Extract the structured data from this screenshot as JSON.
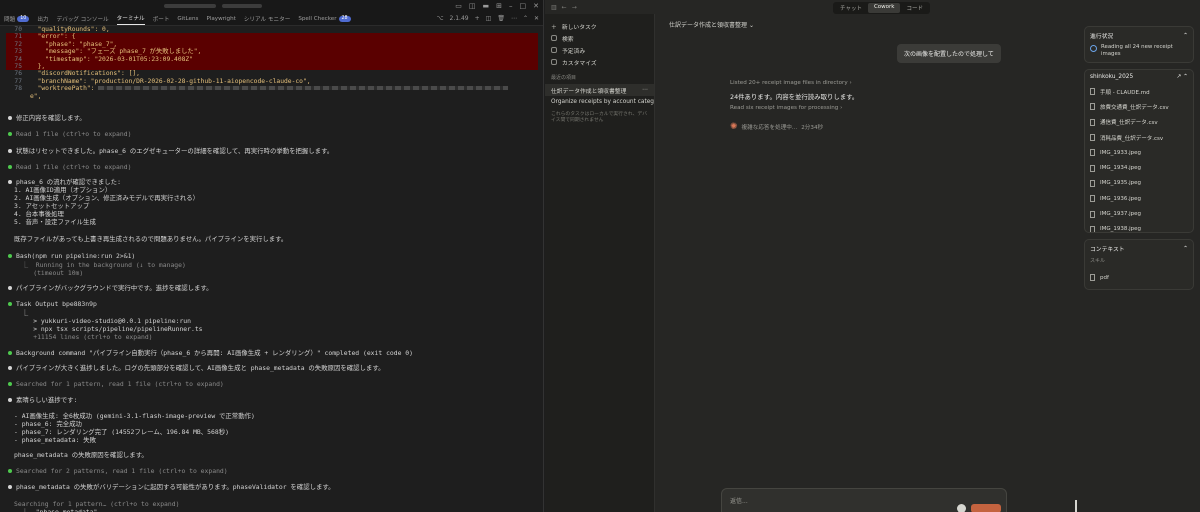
{
  "vscode": {
    "panel_tabs": [
      {
        "label": "問題",
        "badge": "10"
      },
      {
        "label": "出力"
      },
      {
        "label": "デバッグ コンソール"
      },
      {
        "label": "ターミナル",
        "active": true
      },
      {
        "label": "ポート"
      },
      {
        "label": "GitLens"
      },
      {
        "label": "Playwright"
      },
      {
        "label": "シリアル モニター"
      },
      {
        "label": "Spell Checker",
        "badge": "28"
      }
    ],
    "terminal_label": "2.1.49",
    "code_lines": [
      {
        "n": "70",
        "text": "  \"qualityRounds\": 0,"
      },
      {
        "n": "71",
        "text": "  \"error\": {",
        "err": true
      },
      {
        "n": "72",
        "text": "    \"phase\": \"phase_7\",",
        "err": true
      },
      {
        "n": "73",
        "text": "    \"message\": \"フェーズ phase_7 が失敗しました\",",
        "err": true
      },
      {
        "n": "74",
        "text": "    \"timestamp\": \"2026-03-01T05:23:09.408Z\"",
        "err": true
      },
      {
        "n": "75",
        "text": "  },",
        "err": true
      },
      {
        "n": "76",
        "text": "  \"discordNotifications\": [],"
      },
      {
        "n": "77",
        "text": "  \"branchName\": \"production/DR-2026-02-28-github-11-aiopencode-claude-co\","
      },
      {
        "n": "78",
        "text": "  \"worktreePath\":"
      }
    ],
    "wrap_tail": "e\",",
    "messages": [
      {
        "dot": "w",
        "text": "修正内容を確認します。"
      },
      {
        "dot": "g",
        "text": "Read 1 file (ctrl+o to expand)"
      },
      {
        "dot": "w",
        "text": "状態はリセットできました。phase_6 のエグゼキューターの詳細を確認して、再実行時の挙動を把握します。"
      },
      {
        "dot": "g",
        "text": "Read 1 file (ctrl+o to expand)"
      },
      {
        "dot": "w",
        "text": "phase_6 の流れが確認できました:"
      },
      {
        "text": "1. AI画像ID適用（オプション）"
      },
      {
        "text": "2. AI画像生成（オプション、修正済みモデルで再実行される）"
      },
      {
        "text": "3. アセットセットアップ"
      },
      {
        "text": "4. 台本事後処理"
      },
      {
        "text": "5. 音声・設定ファイル生成"
      },
      {
        "text": "既存ファイルがあっても上書き再生成されるので問題ありません。パイプラインを実行します。"
      },
      {
        "dot": "g",
        "text": "Bash(npm run pipeline:run 2>&1)"
      },
      {
        "text": "  ⎿  Running in the background (↓ to manage)"
      },
      {
        "text": "     (timeout 10m)"
      },
      {
        "dot": "w",
        "text": "パイプラインがバックグラウンドで実行中です。進捗を確認します。"
      },
      {
        "dot": "g",
        "text": "Task Output bpe883n9p"
      },
      {
        "text": "  ⎿"
      },
      {
        "text": "     > yukkuri-video-studio@0.0.1 pipeline:run"
      },
      {
        "text": "     > npx tsx scripts/pipeline/pipelineRunner.ts"
      },
      {
        "text": "     +11154 lines (ctrl+o to expand)"
      },
      {
        "dot": "g",
        "text": "Background command \"パイプライン自動実行（phase_6 から再開: AI画像生成 + レンダリング）\" completed (exit code 0)"
      },
      {
        "dot": "w",
        "text": "パイプラインが大きく進捗しました。ログの先頭部分を確認して、AI画像生成と phase_metadata の失敗原因を確認します。"
      },
      {
        "dot": "g",
        "text": "Searched for 1 pattern, read 1 file (ctrl+o to expand)"
      },
      {
        "dot": "w",
        "text": "素晴らしい進捗です:"
      },
      {
        "text": "- AI画像生成: 全6枚成功 (gemini-3.1-flash-image-preview で正常動作)"
      },
      {
        "text": "- phase_6: 完全成功"
      },
      {
        "text": "- phase_7: レンダリング完了 (14552フレーム、196.84 MB、568秒)"
      },
      {
        "text": "- phase_metadata: 失敗"
      },
      {
        "text": "phase_metadata の失敗原因を確認します。"
      },
      {
        "dot": "g",
        "text": "Searched for 2 patterns, read 1 file (ctrl+o to expand)"
      },
      {
        "dot": "w",
        "text": "phase_metadata の失敗がバリデーションに起因する可能性があります。phaseValidator を確認します。"
      },
      {
        "text": "Searching for 1 pattern… (ctrl+o to expand)"
      },
      {
        "text": "  ⎿  \"phase_metadata\""
      }
    ]
  },
  "claude": {
    "mode_tabs": [
      "チャット",
      "Cowork",
      "コード"
    ],
    "active_mode": "Cowork",
    "sidebar": {
      "items": [
        "新しいタスク",
        "検索",
        "予定済み",
        "カスタマイズ"
      ],
      "recent_heading": "最近の項目",
      "recent": [
        "仕訳データ作成と領収書整理",
        "Organize receipts by account categ"
      ],
      "note": "これらのタスクはローカルで実行され、デバイス間で同期されません"
    },
    "main": {
      "task_title": "仕訳データ作成と領収書整理",
      "user_bubble": "次の画像を配置したので処理して",
      "listed": "Listed 20+ receipt image files in directory",
      "reply": "24件あります。内容を並行読み取りします。",
      "sub": "Read six receipt images for processing",
      "thinking": "複雑な応答を処理中...",
      "thinking_time": "2分34秒",
      "composer_placeholder": "返信..."
    },
    "progress": {
      "title": "進行状況",
      "item": "Reading all 24 new receipt images"
    },
    "folder": {
      "title": "shinkoku_2025",
      "files": [
        "手順 - CLAUDE.md",
        "旅費交通費_仕訳データ.csv",
        "通信費_仕訳データ.csv",
        "消耗品費_仕訳データ.csv",
        "IMG_1933.jpeg",
        "IMG_1934.jpeg",
        "IMG_1935.jpeg",
        "IMG_1936.jpeg",
        "IMG_1937.jpeg",
        "IMG_1938.jpeg"
      ]
    },
    "context": {
      "title": "コンテキスト",
      "label": "スキル",
      "skill": "pdf"
    }
  }
}
